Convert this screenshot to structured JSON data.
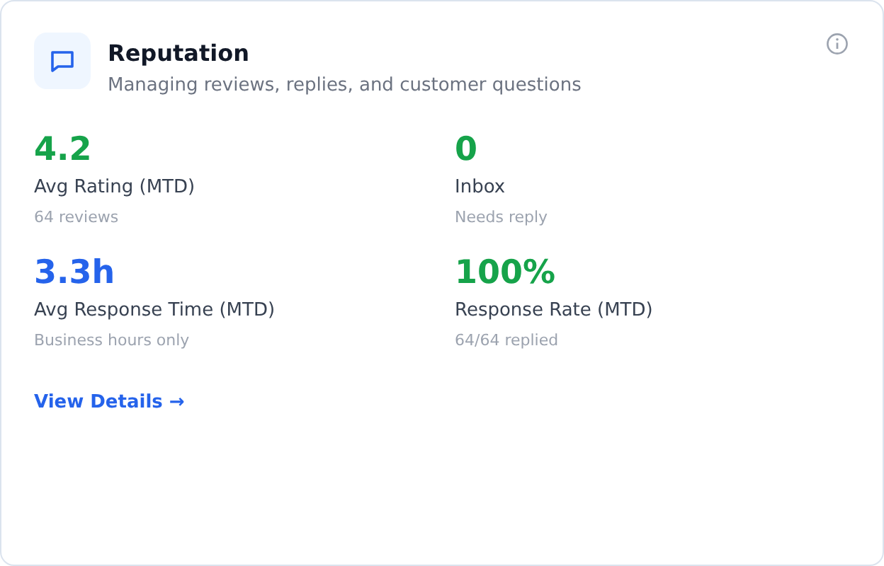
{
  "card": {
    "title": "Reputation",
    "subtitle": "Managing reviews, replies, and customer questions"
  },
  "metrics": [
    {
      "value": "4.2",
      "color": "#16a34a",
      "label": "Avg Rating (MTD)",
      "note": "64 reviews"
    },
    {
      "value": "0",
      "color": "#16a34a",
      "label": "Inbox",
      "note": "Needs reply"
    },
    {
      "value": "3.3h",
      "color": "#2563eb",
      "label": "Avg Response Time (MTD)",
      "note": "Business hours only"
    },
    {
      "value": "100%",
      "color": "#16a34a",
      "label": "Response Rate (MTD)",
      "note": "64/64 replied"
    }
  ],
  "link": "View Details →"
}
